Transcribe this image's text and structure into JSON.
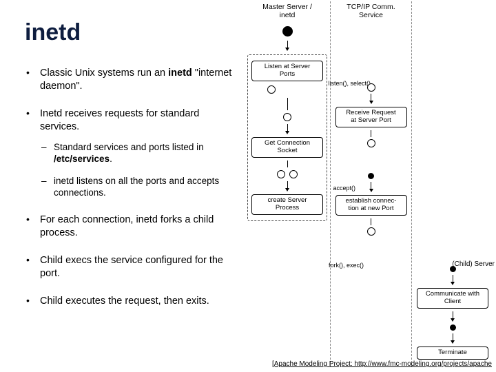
{
  "title": "inetd",
  "bullets": {
    "b1_a": "Classic Unix systems run an ",
    "b1_strong": "inetd",
    "b1_b": " \"internet daemon\".",
    "b2": "Inetd receives requests for standard services.",
    "sub1_a": "Standard services and ports listed in ",
    "sub1_strong": "/etc/services",
    "sub1_b": ".",
    "sub2": "inetd listens on all the ports and accepts connections.",
    "b3": "For each connection, inetd forks a child process.",
    "b4": "Child execs the service configured for the port.",
    "b5": "Child executes the request, then exits."
  },
  "diagram": {
    "col1_header": "Master Server /\ninetd",
    "col2_header": "TCP/IP Comm.\nService",
    "col3_header": "",
    "listen_box": "Listen at Server\nPorts",
    "listen_label": "listen(), select()",
    "recv_box": "Receive Request\nat Server Port",
    "conn_box": "Get Connection\nSocket",
    "accept_label": "accept()",
    "estab_box": "establish connec-\ntion at new Port",
    "create_box": "create Server\nProcess",
    "fork_label": "fork(), exec()",
    "child_label": "(Child) Server",
    "comm_box": "Communicate with\nClient",
    "term_box": "Terminate"
  },
  "credit": "[Apache Modeling Project: http://www.fmc-modeling.org/projects/apache"
}
